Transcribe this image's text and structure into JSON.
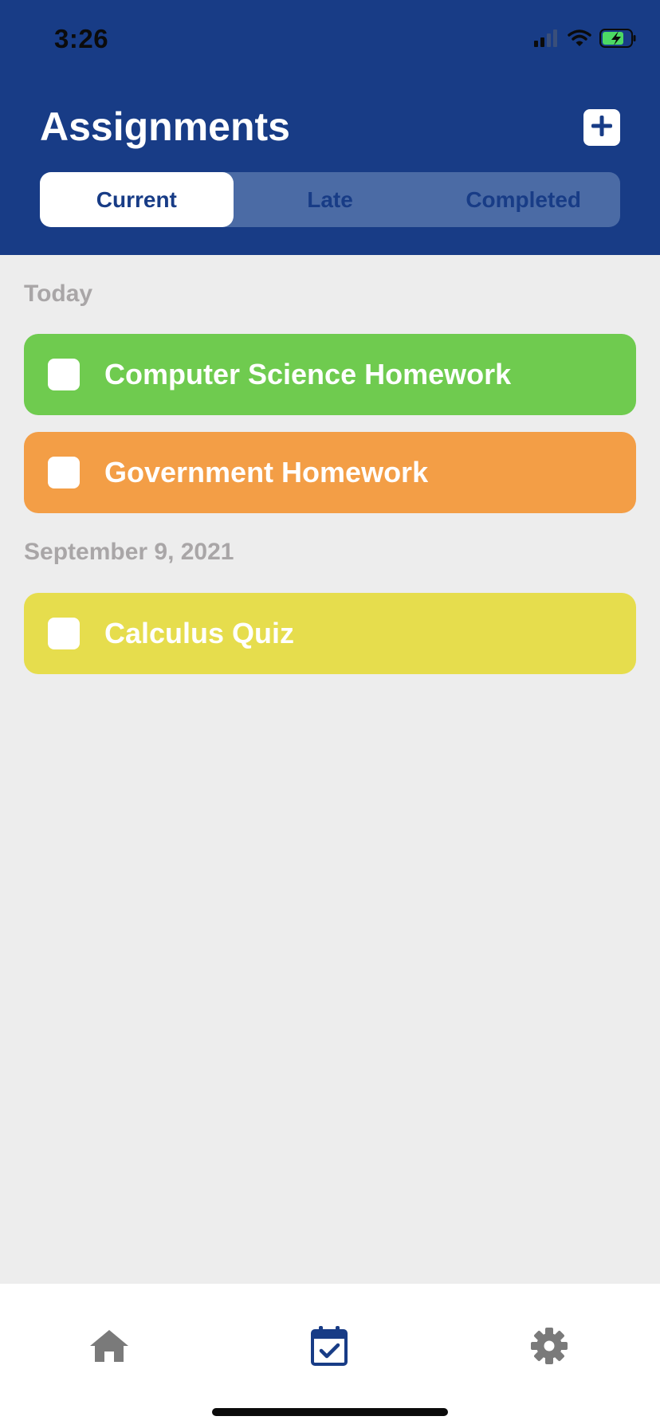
{
  "status_bar": {
    "time": "3:26",
    "icons": [
      "cellular-signal-icon",
      "wifi-icon",
      "battery-charging-icon"
    ]
  },
  "header": {
    "title": "Assignments",
    "add_icon": "plus-icon",
    "background_color": "#183c86"
  },
  "tabs": [
    {
      "label": "Current",
      "active": true
    },
    {
      "label": "Late",
      "active": false
    },
    {
      "label": "Completed",
      "active": false
    }
  ],
  "sections": [
    {
      "title": "Today",
      "items": [
        {
          "label": "Computer Science Homework",
          "color": "#6fcb4f",
          "checked": false
        },
        {
          "label": "Government Homework",
          "color": "#f39e46",
          "checked": false
        }
      ]
    },
    {
      "title": "September 9, 2021",
      "items": [
        {
          "label": "Calculus Quiz",
          "color": "#e6dd4d",
          "checked": false
        }
      ]
    }
  ],
  "tab_bar": {
    "items": [
      {
        "icon": "home-icon",
        "active": false
      },
      {
        "icon": "calendar-check-icon",
        "active": true
      },
      {
        "icon": "gear-icon",
        "active": false
      }
    ],
    "active_color": "#183c86",
    "inactive_color": "#7a7a7a"
  }
}
